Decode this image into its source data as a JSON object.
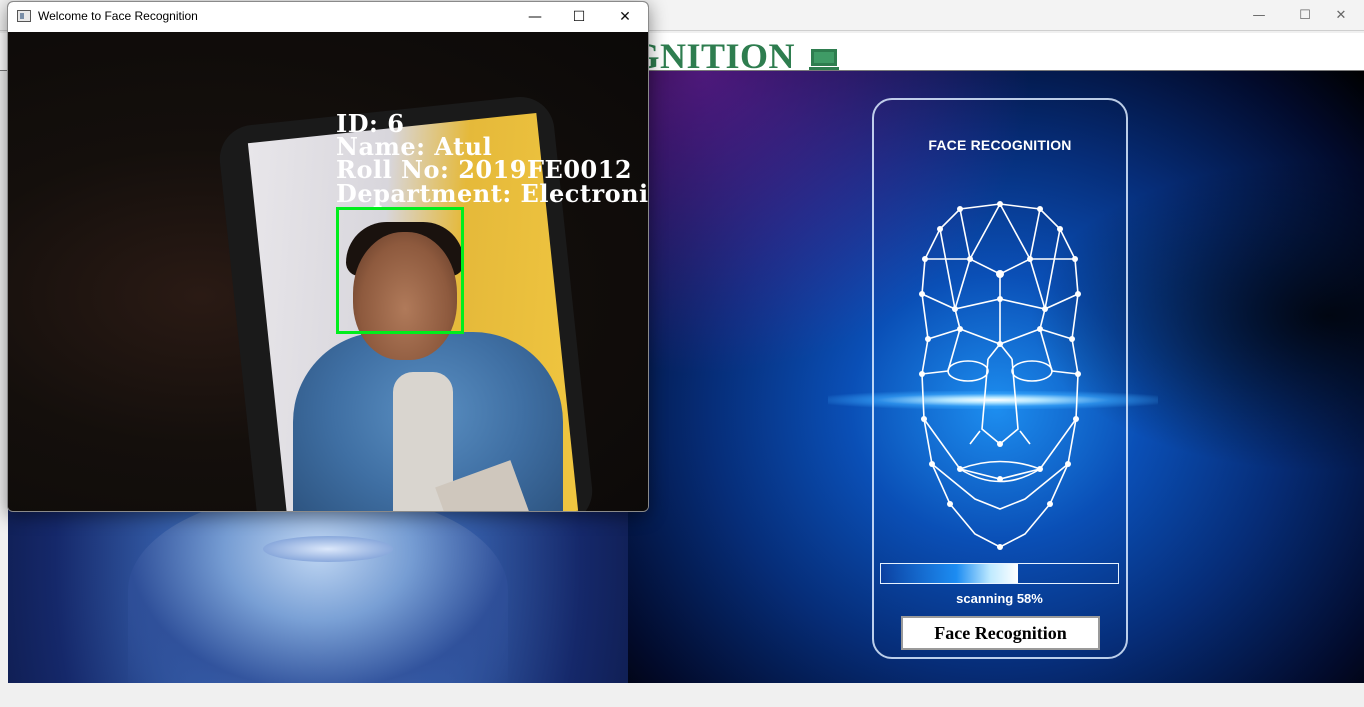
{
  "main_window": {
    "heading": "RECOGNITION",
    "heading_color": "#2e7d4f",
    "controls": {
      "minimize": "—",
      "maximize": "☐",
      "close": "✕"
    }
  },
  "scanner_panel": {
    "title": "FACE RECOGNITION",
    "scan_progress": 0.58,
    "scanning_text": "scanning 58%",
    "button_label": "Face Recognition"
  },
  "camera_window": {
    "title": "Welcome to Face Recognition",
    "controls": {
      "minimize": "—",
      "maximize": "☐",
      "close": "✕"
    },
    "detection": {
      "id_line": "ID: 6",
      "name_line": "Name: Atul",
      "roll_line": "Roll No: 2019FE0012",
      "department_line": "Department: Electronic",
      "box_color": "#00ee1c"
    }
  },
  "icons": {
    "monitor": "monitor-icon",
    "window_app": "window-app-icon"
  }
}
